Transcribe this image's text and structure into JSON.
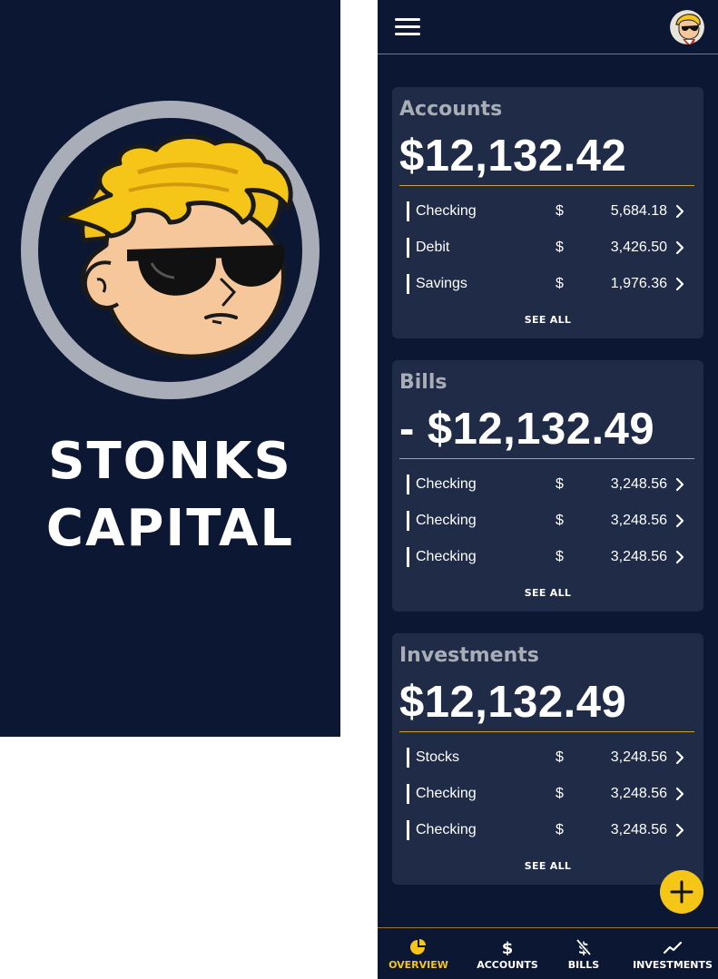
{
  "brand": {
    "line1": "STONKS",
    "line2": "CAPITAL"
  },
  "colors": {
    "navy": "#0c1733",
    "card": "#1f2b47",
    "gold": "#f5c518",
    "muted": "#a9adb6"
  },
  "cards": [
    {
      "title": "Accounts",
      "total": "$12,132.42",
      "rows": [
        {
          "name": "Checking",
          "currency": "$",
          "amount": "5,684.18"
        },
        {
          "name": "Debit",
          "currency": "$",
          "amount": "3,426.50"
        },
        {
          "name": "Savings",
          "currency": "$",
          "amount": "1,976.36"
        }
      ],
      "see_all": "SEE ALL"
    },
    {
      "title": "Bills",
      "total": "- $12,132.49",
      "rows": [
        {
          "name": "Checking",
          "currency": "$",
          "amount": "3,248.56"
        },
        {
          "name": "Checking",
          "currency": "$",
          "amount": "3,248.56"
        },
        {
          "name": "Checking",
          "currency": "$",
          "amount": "3,248.56"
        }
      ],
      "see_all": "SEE ALL"
    },
    {
      "title": "Investments",
      "total": "$12,132.49",
      "rows": [
        {
          "name": "Stocks",
          "currency": "$",
          "amount": "3,248.56"
        },
        {
          "name": "Checking",
          "currency": "$",
          "amount": "3,248.56"
        },
        {
          "name": "Checking",
          "currency": "$",
          "amount": "3,248.56"
        }
      ],
      "see_all": "SEE ALL"
    }
  ],
  "nav": [
    {
      "label": "OVERVIEW",
      "icon": "pie-chart-icon",
      "active": true
    },
    {
      "label": "ACCOUNTS",
      "icon": "dollar-icon",
      "active": false
    },
    {
      "label": "BILLS",
      "icon": "dollar-off-icon",
      "active": false
    },
    {
      "label": "INVESTMENTS",
      "icon": "trend-line-icon",
      "active": false
    }
  ]
}
